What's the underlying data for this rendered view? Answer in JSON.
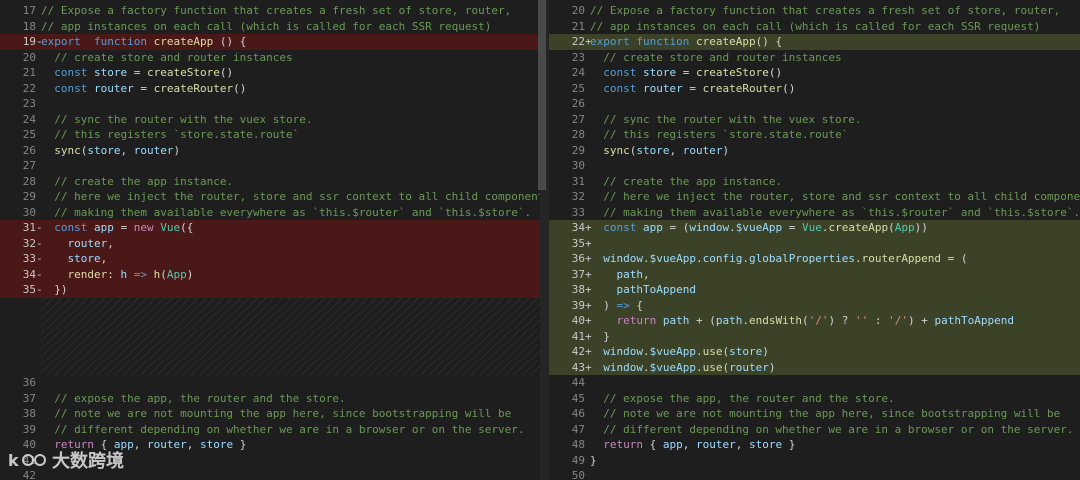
{
  "left_lines": [
    {
      "num": "17",
      "type": "normal",
      "tokens": [
        [
          "c",
          "// Expose a factory function that creates a fresh set of store, router,"
        ]
      ]
    },
    {
      "num": "18",
      "type": "normal",
      "tokens": [
        [
          "c",
          "// app instances on each call (which is called for each SSR request)"
        ]
      ]
    },
    {
      "num": "19",
      "type": "del",
      "tokens": [
        [
          "k",
          "export"
        ],
        [
          "",
          "  "
        ],
        [
          "k",
          "function"
        ],
        [
          "",
          " "
        ],
        [
          "f",
          "createApp"
        ],
        [
          "",
          " () {"
        ]
      ]
    },
    {
      "num": "20",
      "type": "normal",
      "tokens": [
        [
          "",
          "  "
        ],
        [
          "c",
          "// create store and router instances"
        ]
      ]
    },
    {
      "num": "21",
      "type": "normal",
      "tokens": [
        [
          "",
          "  "
        ],
        [
          "k",
          "const"
        ],
        [
          "",
          " "
        ],
        [
          "v",
          "store"
        ],
        [
          "",
          " = "
        ],
        [
          "f",
          "createStore"
        ],
        [
          "",
          "()"
        ]
      ]
    },
    {
      "num": "22",
      "type": "normal",
      "tokens": [
        [
          "",
          "  "
        ],
        [
          "k",
          "const"
        ],
        [
          "",
          " "
        ],
        [
          "v",
          "router"
        ],
        [
          "",
          " = "
        ],
        [
          "f",
          "createRouter"
        ],
        [
          "",
          "()"
        ]
      ]
    },
    {
      "num": "23",
      "type": "normal",
      "tokens": []
    },
    {
      "num": "24",
      "type": "normal",
      "tokens": [
        [
          "",
          "  "
        ],
        [
          "c",
          "// sync the router with the vuex store."
        ]
      ]
    },
    {
      "num": "25",
      "type": "normal",
      "tokens": [
        [
          "",
          "  "
        ],
        [
          "c",
          "// this registers `store.state.route`"
        ]
      ]
    },
    {
      "num": "26",
      "type": "normal",
      "tokens": [
        [
          "",
          "  "
        ],
        [
          "f",
          "sync"
        ],
        [
          "",
          "("
        ],
        [
          "v",
          "store"
        ],
        [
          "",
          ", "
        ],
        [
          "v",
          "router"
        ],
        [
          "",
          ")"
        ]
      ]
    },
    {
      "num": "27",
      "type": "normal",
      "tokens": []
    },
    {
      "num": "28",
      "type": "normal",
      "tokens": [
        [
          "",
          "  "
        ],
        [
          "c",
          "// create the app instance."
        ]
      ]
    },
    {
      "num": "29",
      "type": "normal",
      "tokens": [
        [
          "",
          "  "
        ],
        [
          "c",
          "// here we inject the router, store and ssr context to all child components,"
        ]
      ]
    },
    {
      "num": "30",
      "type": "normal",
      "tokens": [
        [
          "",
          "  "
        ],
        [
          "c",
          "// making them available everywhere as `this.$router` and `this.$store`."
        ]
      ]
    },
    {
      "num": "31",
      "type": "del",
      "tokens": [
        [
          "",
          "  "
        ],
        [
          "k",
          "const"
        ],
        [
          "",
          " "
        ],
        [
          "v",
          "app"
        ],
        [
          "",
          " = "
        ],
        [
          "kc",
          "new"
        ],
        [
          "",
          " "
        ],
        [
          "cls",
          "Vue"
        ],
        [
          "",
          "({"
        ]
      ]
    },
    {
      "num": "32",
      "type": "del",
      "tokens": [
        [
          "",
          "    "
        ],
        [
          "v",
          "router"
        ],
        [
          "",
          ","
        ]
      ]
    },
    {
      "num": "33",
      "type": "del",
      "tokens": [
        [
          "",
          "    "
        ],
        [
          "v",
          "store"
        ],
        [
          "",
          ","
        ]
      ]
    },
    {
      "num": "34",
      "type": "del",
      "tokens": [
        [
          "",
          "    "
        ],
        [
          "f",
          "render"
        ],
        [
          "",
          ": "
        ],
        [
          "v",
          "h"
        ],
        [
          "",
          " "
        ],
        [
          "k",
          "=>"
        ],
        [
          "",
          " "
        ],
        [
          "f",
          "h"
        ],
        [
          "",
          "("
        ],
        [
          "cls",
          "App"
        ],
        [
          "",
          ")"
        ]
      ]
    },
    {
      "num": "35",
      "type": "del",
      "tokens": [
        [
          "",
          "  })"
        ]
      ]
    },
    {
      "num": "",
      "type": "filler",
      "tokens": []
    },
    {
      "num": "",
      "type": "filler",
      "tokens": []
    },
    {
      "num": "",
      "type": "filler",
      "tokens": []
    },
    {
      "num": "",
      "type": "filler",
      "tokens": []
    },
    {
      "num": "",
      "type": "filler",
      "tokens": []
    },
    {
      "num": "36",
      "type": "normal",
      "tokens": []
    },
    {
      "num": "37",
      "type": "normal",
      "tokens": [
        [
          "",
          "  "
        ],
        [
          "c",
          "// expose the app, the router and the store."
        ]
      ]
    },
    {
      "num": "38",
      "type": "normal",
      "tokens": [
        [
          "",
          "  "
        ],
        [
          "c",
          "// note we are not mounting the app here, since bootstrapping will be"
        ]
      ]
    },
    {
      "num": "39",
      "type": "normal",
      "tokens": [
        [
          "",
          "  "
        ],
        [
          "c",
          "// different depending on whether we are in a browser or on the server."
        ]
      ]
    },
    {
      "num": "40",
      "type": "normal",
      "tokens": [
        [
          "",
          "  "
        ],
        [
          "kc",
          "return"
        ],
        [
          "",
          " { "
        ],
        [
          "v",
          "app"
        ],
        [
          "",
          ", "
        ],
        [
          "v",
          "router"
        ],
        [
          "",
          ", "
        ],
        [
          "v",
          "store"
        ],
        [
          "",
          " }"
        ]
      ]
    },
    {
      "num": "41",
      "type": "normal",
      "tokens": []
    },
    {
      "num": "42",
      "type": "normal",
      "tokens": []
    }
  ],
  "right_lines": [
    {
      "num": "20",
      "type": "normal",
      "tokens": [
        [
          "c",
          "// Expose a factory function that creates a fresh set of store, router,"
        ]
      ]
    },
    {
      "num": "21",
      "type": "normal",
      "tokens": [
        [
          "c",
          "// app instances on each call (which is called for each SSR request)"
        ]
      ]
    },
    {
      "num": "22",
      "type": "ins",
      "tokens": [
        [
          "k",
          "export"
        ],
        [
          "",
          " "
        ],
        [
          "k",
          "function"
        ],
        [
          "",
          " "
        ],
        [
          "f",
          "createApp"
        ],
        [
          "",
          "() {"
        ]
      ]
    },
    {
      "num": "23",
      "type": "normal",
      "tokens": [
        [
          "",
          "  "
        ],
        [
          "c",
          "// create store and router instances"
        ]
      ]
    },
    {
      "num": "24",
      "type": "normal",
      "tokens": [
        [
          "",
          "  "
        ],
        [
          "k",
          "const"
        ],
        [
          "",
          " "
        ],
        [
          "v",
          "store"
        ],
        [
          "",
          " = "
        ],
        [
          "f",
          "createStore"
        ],
        [
          "",
          "()"
        ]
      ]
    },
    {
      "num": "25",
      "type": "normal",
      "tokens": [
        [
          "",
          "  "
        ],
        [
          "k",
          "const"
        ],
        [
          "",
          " "
        ],
        [
          "v",
          "router"
        ],
        [
          "",
          " = "
        ],
        [
          "f",
          "createRouter"
        ],
        [
          "",
          "()"
        ]
      ]
    },
    {
      "num": "26",
      "type": "normal",
      "tokens": []
    },
    {
      "num": "27",
      "type": "normal",
      "tokens": [
        [
          "",
          "  "
        ],
        [
          "c",
          "// sync the router with the vuex store."
        ]
      ]
    },
    {
      "num": "28",
      "type": "normal",
      "tokens": [
        [
          "",
          "  "
        ],
        [
          "c",
          "// this registers `store.state.route`"
        ]
      ]
    },
    {
      "num": "29",
      "type": "normal",
      "tokens": [
        [
          "",
          "  "
        ],
        [
          "f",
          "sync"
        ],
        [
          "",
          "("
        ],
        [
          "v",
          "store"
        ],
        [
          "",
          ", "
        ],
        [
          "v",
          "router"
        ],
        [
          "",
          ")"
        ]
      ]
    },
    {
      "num": "30",
      "type": "normal",
      "tokens": []
    },
    {
      "num": "31",
      "type": "normal",
      "tokens": [
        [
          "",
          "  "
        ],
        [
          "c",
          "// create the app instance."
        ]
      ]
    },
    {
      "num": "32",
      "type": "normal",
      "tokens": [
        [
          "",
          "  "
        ],
        [
          "c",
          "// here we inject the router, store and ssr context to all child components,"
        ]
      ]
    },
    {
      "num": "33",
      "type": "normal",
      "tokens": [
        [
          "",
          "  "
        ],
        [
          "c",
          "// making them available everywhere as `this.$router` and `this.$store`."
        ]
      ]
    },
    {
      "num": "34",
      "type": "ins",
      "tokens": [
        [
          "",
          "  "
        ],
        [
          "k",
          "const"
        ],
        [
          "",
          " "
        ],
        [
          "v",
          "app"
        ],
        [
          "",
          " = ("
        ],
        [
          "v",
          "window"
        ],
        [
          "",
          "."
        ],
        [
          "v",
          "$vueApp"
        ],
        [
          "",
          " = "
        ],
        [
          "cls",
          "Vue"
        ],
        [
          "",
          "."
        ],
        [
          "f",
          "createApp"
        ],
        [
          "",
          "("
        ],
        [
          "cls",
          "App"
        ],
        [
          "",
          "))"
        ]
      ]
    },
    {
      "num": "35",
      "type": "ins",
      "tokens": []
    },
    {
      "num": "36",
      "type": "ins",
      "tokens": [
        [
          "",
          "  "
        ],
        [
          "v",
          "window"
        ],
        [
          "",
          "."
        ],
        [
          "v",
          "$vueApp"
        ],
        [
          "",
          "."
        ],
        [
          "v",
          "config"
        ],
        [
          "",
          "."
        ],
        [
          "v",
          "globalProperties"
        ],
        [
          "",
          "."
        ],
        [
          "f",
          "routerAppend"
        ],
        [
          "",
          " = ("
        ]
      ]
    },
    {
      "num": "37",
      "type": "ins",
      "tokens": [
        [
          "",
          "    "
        ],
        [
          "v",
          "path"
        ],
        [
          "",
          ","
        ]
      ]
    },
    {
      "num": "38",
      "type": "ins",
      "tokens": [
        [
          "",
          "    "
        ],
        [
          "v",
          "pathToAppend"
        ]
      ]
    },
    {
      "num": "39",
      "type": "ins",
      "tokens": [
        [
          "",
          "  ) "
        ],
        [
          "k",
          "=>"
        ],
        [
          "",
          " {"
        ]
      ]
    },
    {
      "num": "40",
      "type": "ins",
      "tokens": [
        [
          "",
          "    "
        ],
        [
          "kc",
          "return"
        ],
        [
          "",
          " "
        ],
        [
          "v",
          "path"
        ],
        [
          "",
          " + ("
        ],
        [
          "v",
          "path"
        ],
        [
          "",
          "."
        ],
        [
          "f",
          "endsWith"
        ],
        [
          "",
          "("
        ],
        [
          "s",
          "'/'"
        ],
        [
          "",
          ") ? "
        ],
        [
          "s",
          "''"
        ],
        [
          "",
          " : "
        ],
        [
          "s",
          "'/'"
        ],
        [
          "",
          ") + "
        ],
        [
          "v",
          "pathToAppend"
        ]
      ]
    },
    {
      "num": "41",
      "type": "ins",
      "tokens": [
        [
          "",
          "  }"
        ]
      ]
    },
    {
      "num": "42",
      "type": "ins",
      "tokens": [
        [
          "",
          "  "
        ],
        [
          "v",
          "window"
        ],
        [
          "",
          "."
        ],
        [
          "v",
          "$vueApp"
        ],
        [
          "",
          "."
        ],
        [
          "f",
          "use"
        ],
        [
          "",
          "("
        ],
        [
          "v",
          "store"
        ],
        [
          "",
          ")"
        ]
      ]
    },
    {
      "num": "43",
      "type": "ins",
      "tokens": [
        [
          "",
          "  "
        ],
        [
          "v",
          "window"
        ],
        [
          "",
          "."
        ],
        [
          "v",
          "$vueApp"
        ],
        [
          "",
          "."
        ],
        [
          "f",
          "use"
        ],
        [
          "",
          "("
        ],
        [
          "v",
          "router"
        ],
        [
          "",
          ")"
        ]
      ]
    },
    {
      "num": "44",
      "type": "normal",
      "tokens": []
    },
    {
      "num": "45",
      "type": "normal",
      "tokens": [
        [
          "",
          "  "
        ],
        [
          "c",
          "// expose the app, the router and the store."
        ]
      ]
    },
    {
      "num": "46",
      "type": "normal",
      "tokens": [
        [
          "",
          "  "
        ],
        [
          "c",
          "// note we are not mounting the app here, since bootstrapping will be"
        ]
      ]
    },
    {
      "num": "47",
      "type": "normal",
      "tokens": [
        [
          "",
          "  "
        ],
        [
          "c",
          "// different depending on whether we are in a browser or on the server."
        ]
      ]
    },
    {
      "num": "48",
      "type": "normal",
      "tokens": [
        [
          "",
          "  "
        ],
        [
          "kc",
          "return"
        ],
        [
          "",
          " { "
        ],
        [
          "v",
          "app"
        ],
        [
          "",
          ", "
        ],
        [
          "v",
          "router"
        ],
        [
          "",
          ", "
        ],
        [
          "v",
          "store"
        ],
        [
          "",
          " }"
        ]
      ]
    },
    {
      "num": "49",
      "type": "normal",
      "tokens": [
        [
          "",
          "}"
        ]
      ]
    },
    {
      "num": "50",
      "type": "normal",
      "tokens": []
    }
  ],
  "watermark": {
    "text": "大数跨境"
  },
  "colors": {
    "removed_bg": "#4b1818",
    "added_bg": "#3b4227",
    "background": "#1e1e1e"
  }
}
